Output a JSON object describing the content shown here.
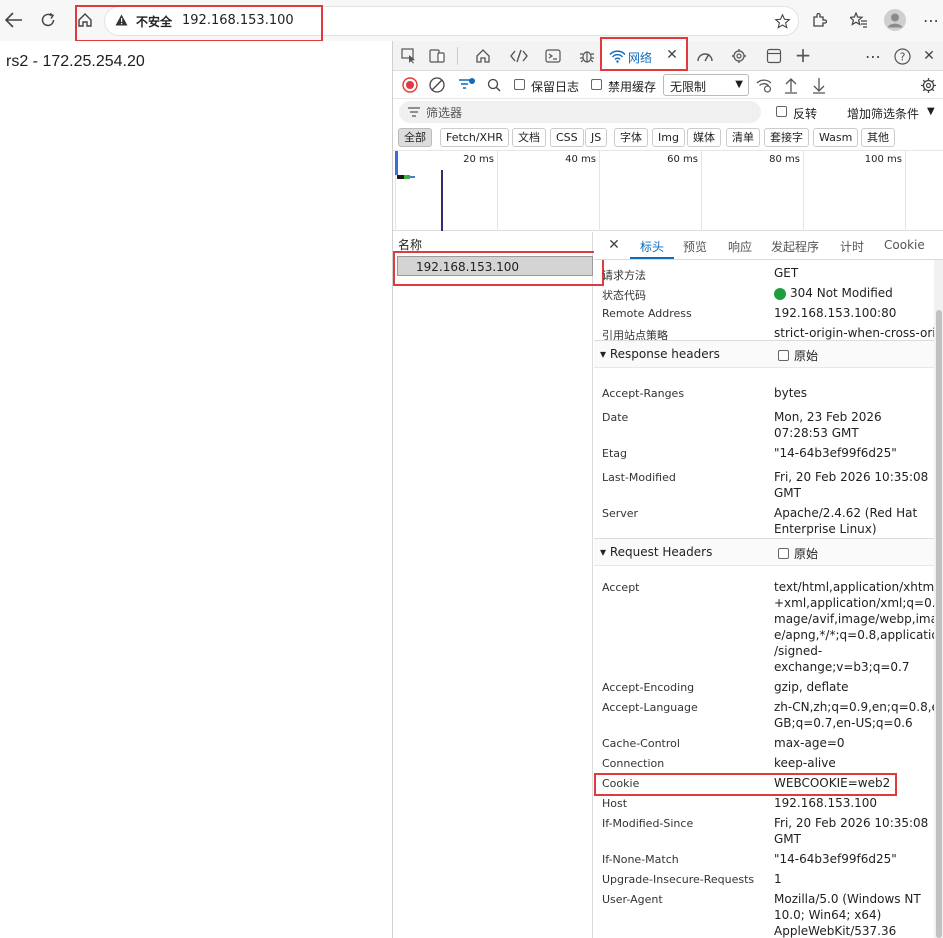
{
  "browser": {
    "security_label": "不安全",
    "url": "192.168.153.100"
  },
  "page": {
    "body_text": "rs2 - 172.25.254.20"
  },
  "devtools": {
    "active_tab": "网络",
    "controls": {
      "preserve_log": "保留日志",
      "disable_cache": "禁用缓存",
      "throttle": "无限制"
    },
    "filter": {
      "placeholder": "筛选器",
      "invert": "反转",
      "more_filters": "增加筛选条件"
    },
    "type_filters": [
      "全部",
      "Fetch/XHR",
      "文档",
      "CSS",
      "JS",
      "字体",
      "Img",
      "媒体",
      "清单",
      "套接字",
      "Wasm",
      "其他"
    ],
    "timeline_ticks": [
      "20 ms",
      "40 ms",
      "60 ms",
      "80 ms",
      "100 ms"
    ],
    "name_column": {
      "header": "名称",
      "requests": [
        "192.168.153.100"
      ]
    },
    "detail_tabs": [
      "标头",
      "预览",
      "响应",
      "发起程序",
      "计时",
      "Cookie"
    ],
    "general": [
      {
        "name": "请求方法",
        "value": "GET"
      },
      {
        "name": "状态代码",
        "value": "304 Not Modified",
        "status_color": "#1e9e3e"
      },
      {
        "name": "Remote Address",
        "value": "192.168.153.100:80"
      },
      {
        "name": "引用站点策略",
        "value": "strict-origin-when-cross-origin"
      }
    ],
    "response_headers": {
      "title": "Response headers",
      "raw_label": "原始",
      "items": [
        {
          "name": "Accept-Ranges",
          "lines": [
            "bytes"
          ]
        },
        {
          "name": "Date",
          "lines": [
            "Mon, 23 Feb 2026",
            "07:28:53 GMT"
          ]
        },
        {
          "name": "Etag",
          "lines": [
            "\"14-64b3ef99f6d25\""
          ]
        },
        {
          "name": "Last-Modified",
          "lines": [
            "Fri, 20 Feb 2026 10:35:08",
            "GMT"
          ]
        },
        {
          "name": "Server",
          "lines": [
            "Apache/2.4.62 (Red Hat",
            "Enterprise Linux)"
          ]
        }
      ]
    },
    "request_headers": {
      "title": "Request Headers",
      "raw_label": "原始",
      "items": [
        {
          "name": "Accept",
          "lines": [
            "text/html,application/xhtml",
            "+xml,application/xml;q=0.9,i",
            "mage/avif,image/webp,imag",
            "e/apng,*/*;q=0.8,application",
            "/signed-",
            "exchange;v=b3;q=0.7"
          ]
        },
        {
          "name": "Accept-Encoding",
          "lines": [
            "gzip, deflate"
          ]
        },
        {
          "name": "Accept-Language",
          "lines": [
            "zh-CN,zh;q=0.9,en;q=0.8,en-",
            "GB;q=0.7,en-US;q=0.6"
          ]
        },
        {
          "name": "Cache-Control",
          "lines": [
            "max-age=0"
          ]
        },
        {
          "name": "Connection",
          "lines": [
            "keep-alive"
          ]
        },
        {
          "name": "Cookie",
          "lines": [
            "WEBCOOKIE=web2"
          ]
        },
        {
          "name": "Host",
          "lines": [
            "192.168.153.100"
          ]
        },
        {
          "name": "If-Modified-Since",
          "lines": [
            "Fri, 20 Feb 2026 10:35:08",
            "GMT"
          ]
        },
        {
          "name": "If-None-Match",
          "lines": [
            "\"14-64b3ef99f6d25\""
          ]
        },
        {
          "name": "Upgrade-Insecure-Requests",
          "lines": [
            "1"
          ]
        },
        {
          "name": "User-Agent",
          "lines": [
            "Mozilla/5.0 (Windows NT",
            "10.0; Win64; x64)",
            "AppleWebKit/537.36"
          ]
        }
      ]
    }
  },
  "colors": {
    "accent": "#0f6cbd",
    "highlight": "#e0393e",
    "record": "#e0393e"
  }
}
